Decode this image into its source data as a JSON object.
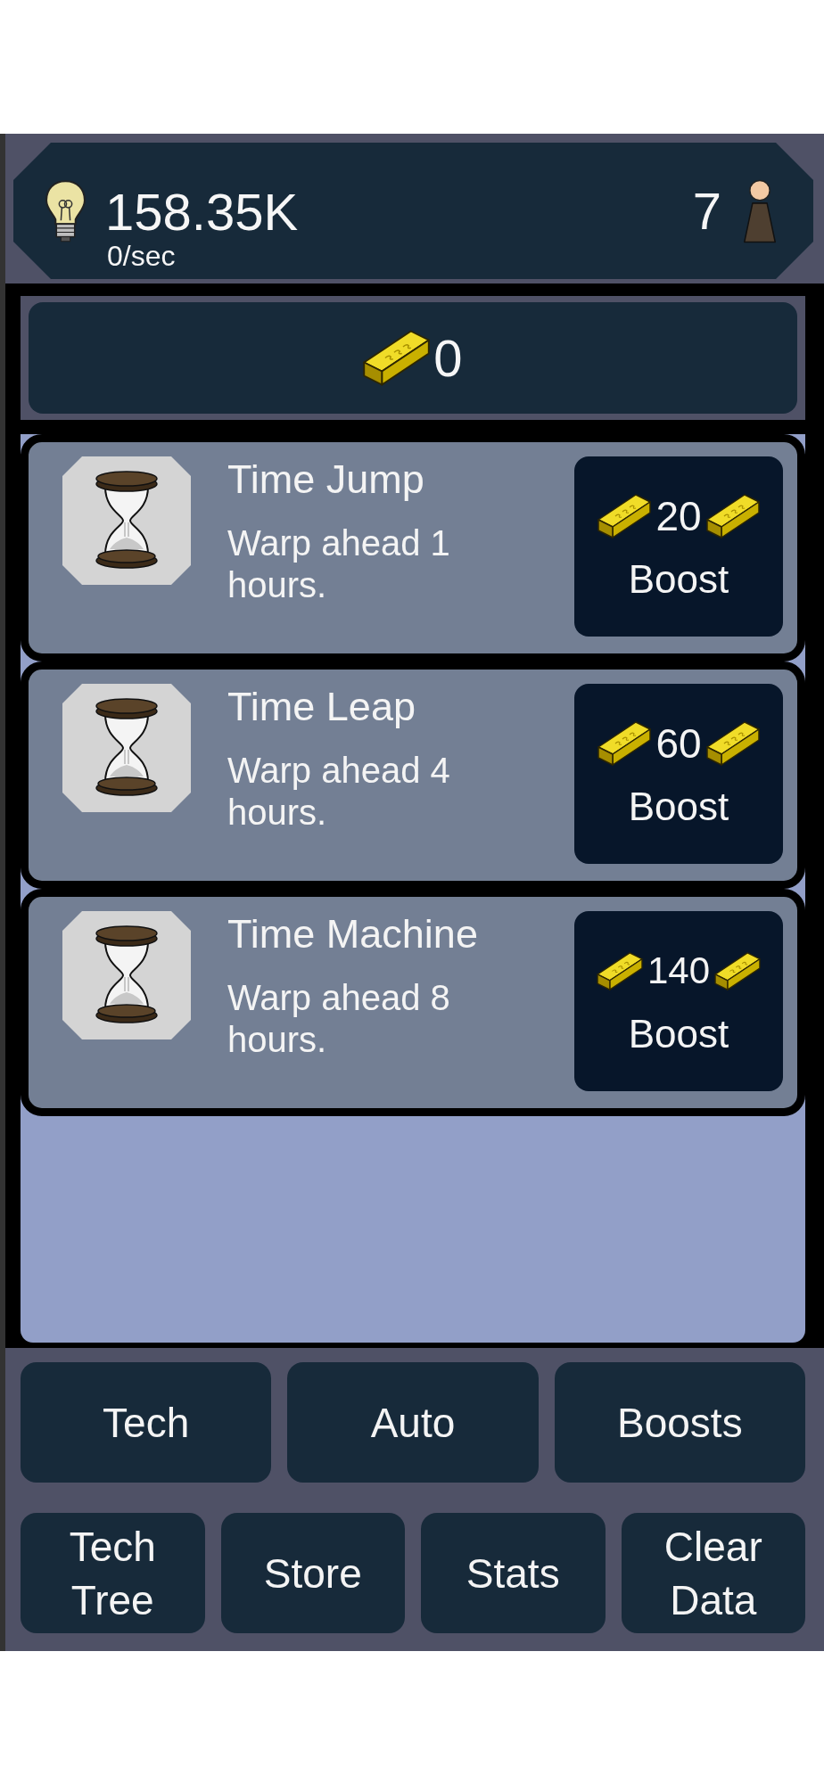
{
  "header": {
    "energy": "158.35K",
    "rate": "0/sec",
    "population": "7"
  },
  "gold": {
    "amount": "0"
  },
  "boosts": [
    {
      "title": "Time Jump",
      "description": "Warp ahead 1 hours.",
      "cost": "20",
      "action": "Boost"
    },
    {
      "title": "Time Leap",
      "description": "Warp ahead 4 hours.",
      "cost": "60",
      "action": "Boost"
    },
    {
      "title": "Time Machine",
      "description": "Warp ahead 8 hours.",
      "cost": "140",
      "action": "Boost"
    }
  ],
  "nav_rows": [
    {
      "buttons": [
        "Tech",
        "Auto",
        "Boosts"
      ]
    },
    {
      "buttons": [
        "Tech Tree",
        "Store",
        "Stats",
        "Clear Data"
      ]
    }
  ]
}
